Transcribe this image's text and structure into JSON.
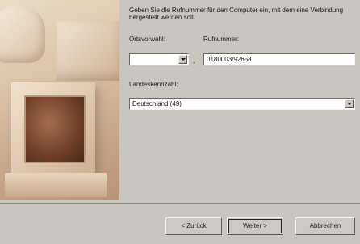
{
  "intro_text": "Geben Sie die Rufnummer für den Computer ein, mit dem eine Verbindung hergestellt werden soll.",
  "area_code": {
    "label": "Ortsvorwahl:",
    "value": ""
  },
  "phone_number": {
    "label": "Rufnummer:",
    "value": "0180003/92658"
  },
  "separator": "-",
  "country": {
    "label": "Landeskennzahl:",
    "value": "Deutschland (49)"
  },
  "buttons": {
    "back": "< Zurück",
    "next": "Weiter >",
    "cancel": "Abbrechen"
  }
}
